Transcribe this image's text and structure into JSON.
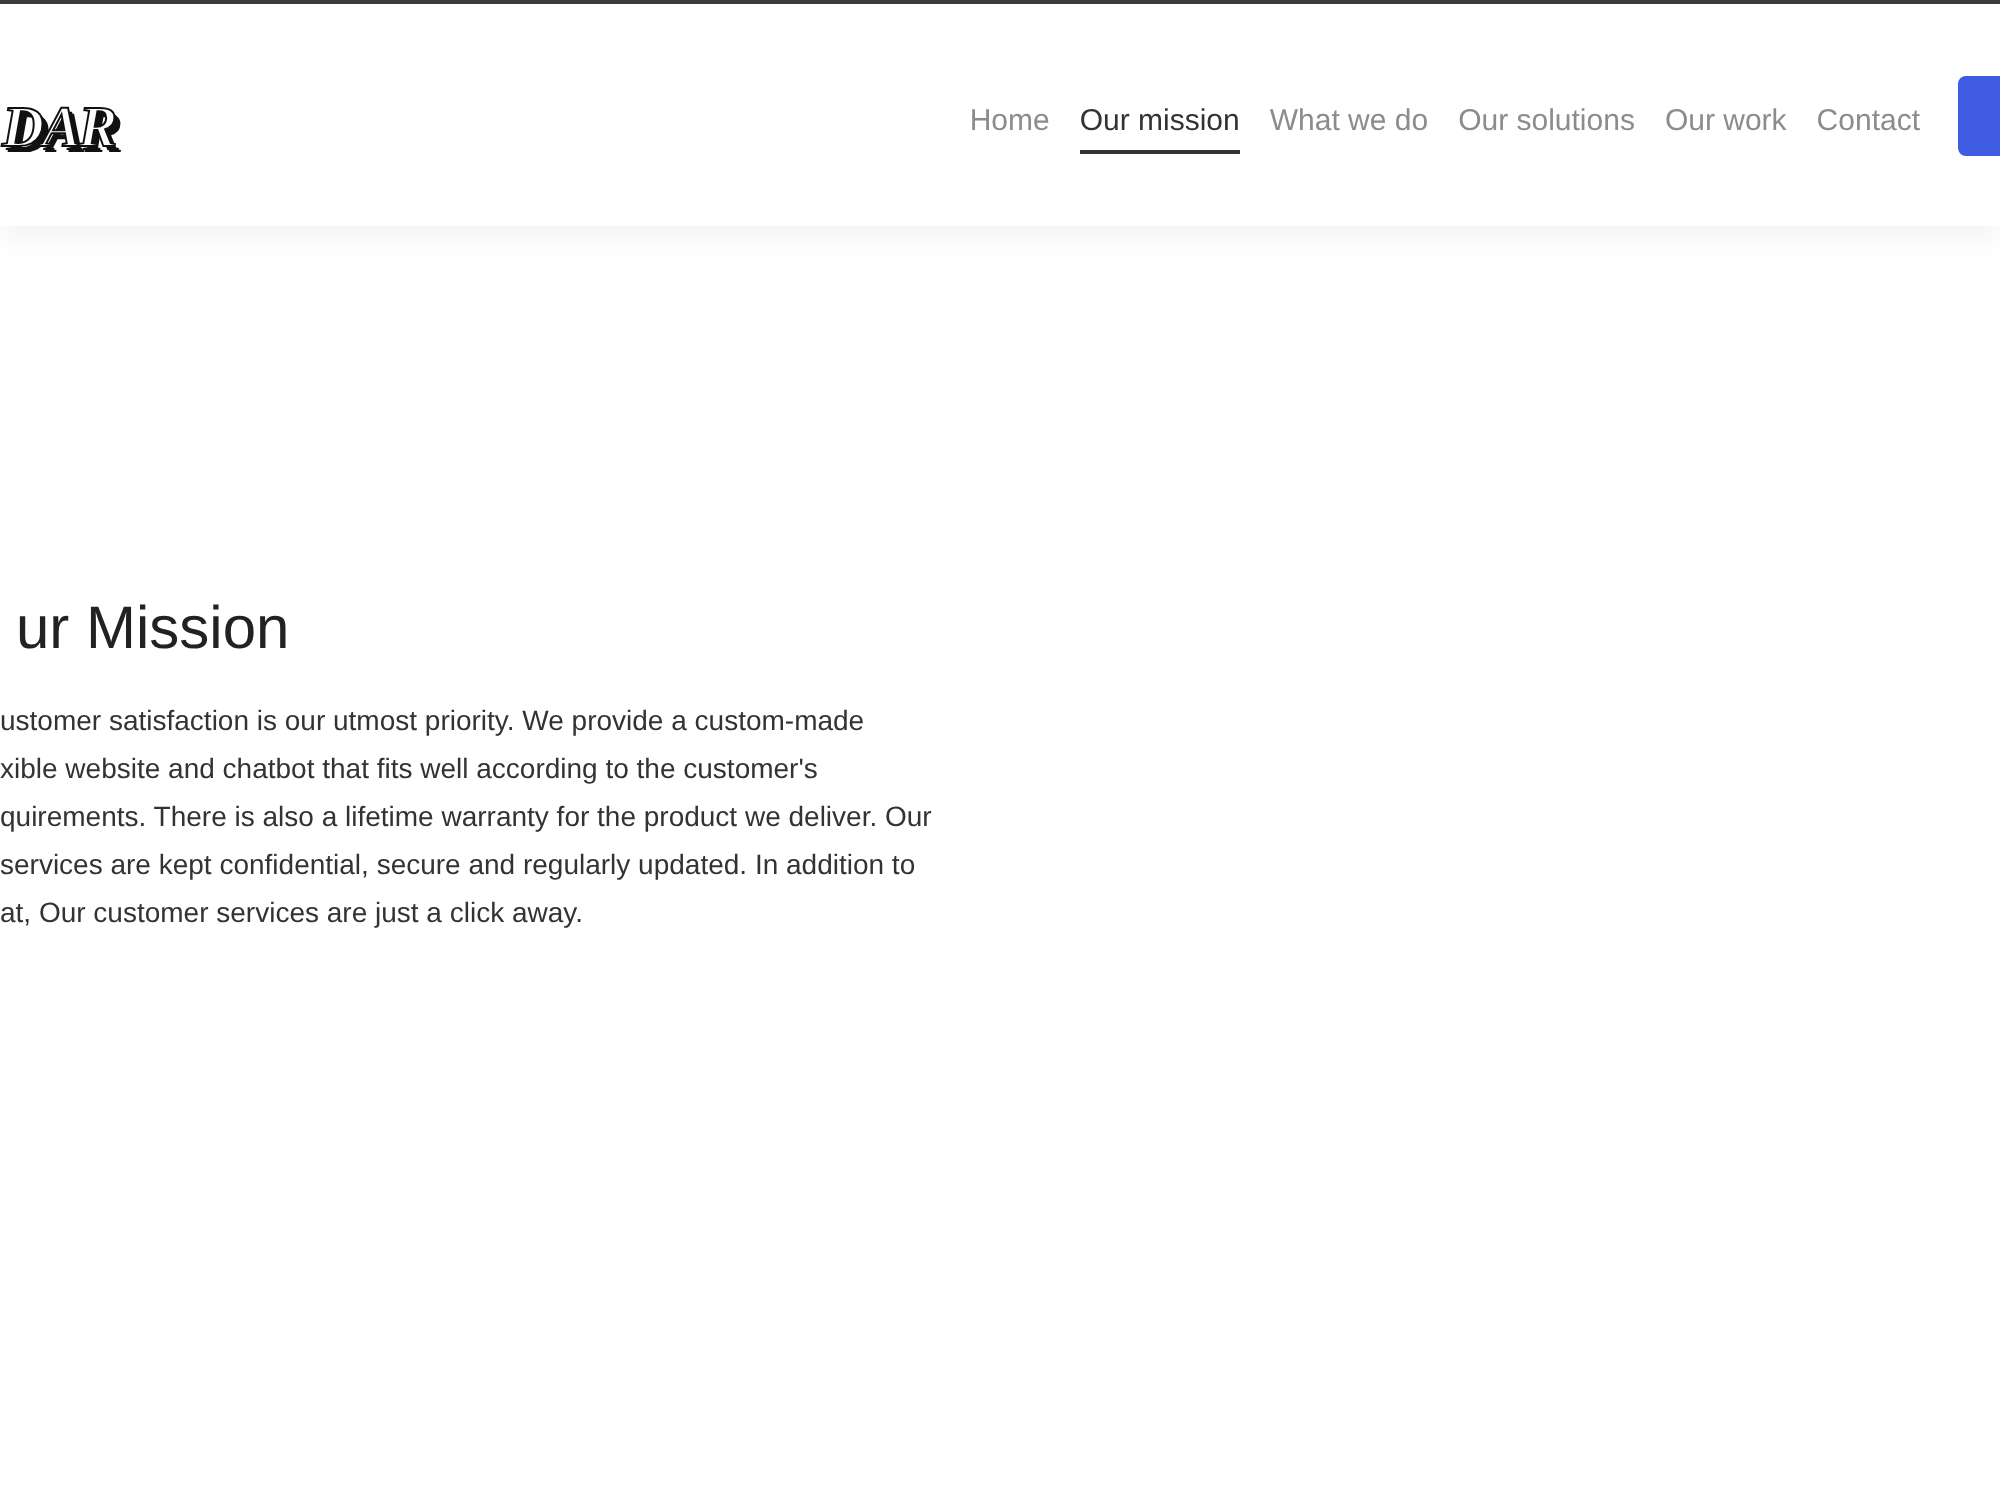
{
  "header": {
    "logo": "DAR",
    "nav": [
      {
        "label": "Home",
        "selected": false
      },
      {
        "label": "Our mission",
        "selected": true
      },
      {
        "label": "What we do",
        "selected": false
      },
      {
        "label": "Our solutions",
        "selected": false
      },
      {
        "label": "Our work",
        "selected": false
      },
      {
        "label": "Contact",
        "selected": false
      }
    ]
  },
  "mission": {
    "title": "ur Mission",
    "lines": [
      "ustomer satisfaction is our utmost priority. We provide a custom-made",
      "xible website and chatbot that fits well according to the customer's",
      "quirements. There is also a lifetime warranty for the product we deliver. Our",
      "services are kept confidential, secure and regularly updated. In addition to",
      "at, Our customer services are just a click away."
    ]
  }
}
